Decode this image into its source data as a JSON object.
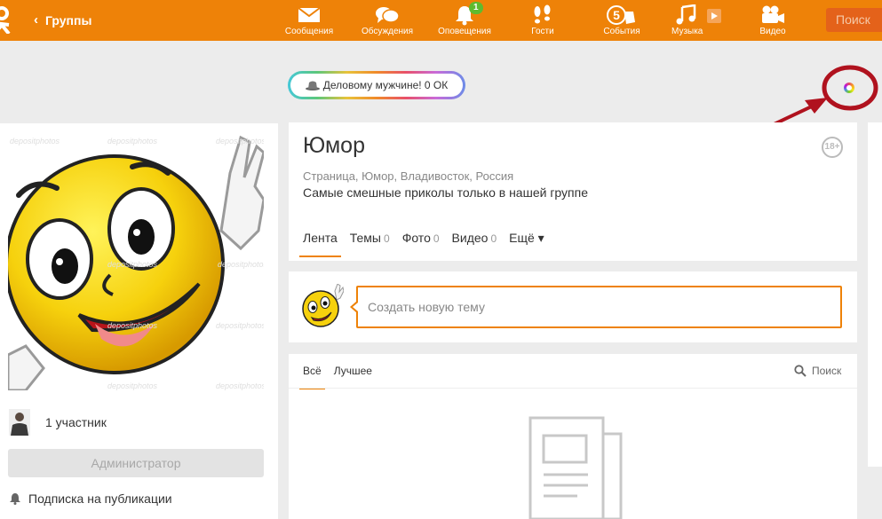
{
  "topbar": {
    "back_label": "Группы",
    "search_label": "Поиск",
    "nav": [
      {
        "label": "Сообщения",
        "icon": "envelope-icon"
      },
      {
        "label": "Обсуждения",
        "icon": "chat-bubbles-icon"
      },
      {
        "label": "Оповещения",
        "icon": "bell-icon",
        "badge": "1"
      },
      {
        "label": "Гости",
        "icon": "footprints-icon"
      },
      {
        "label": "События",
        "icon": "five-plus-icon"
      },
      {
        "label": "Музыка",
        "icon": "music-note-icon"
      },
      {
        "label": "Видео",
        "icon": "video-camera-icon"
      }
    ]
  },
  "promo": {
    "text": "Деловому мужчине! 0 ОК",
    "icon": "hat-icon"
  },
  "left": {
    "members_text": "1 участник",
    "admin_button": "Администратор",
    "subscribe_text": "Подписка на публикации",
    "watermark": "depositphotos"
  },
  "group": {
    "title": "Юмор",
    "age_badge": "18+",
    "meta": "Страница, Юмор, Владивосток, Россия",
    "description": "Самые смешные приколы только в нашей группе",
    "tabs": [
      {
        "label": "Лента",
        "count": "",
        "active": true
      },
      {
        "label": "Темы",
        "count": "0"
      },
      {
        "label": "Фото",
        "count": "0"
      },
      {
        "label": "Видео",
        "count": "0"
      },
      {
        "label": "Ещё ▾",
        "count": ""
      }
    ]
  },
  "new_topic": {
    "placeholder": "Создать новую тему"
  },
  "feed": {
    "tabs": [
      {
        "label": "Всё",
        "active": true
      },
      {
        "label": "Лучшее"
      }
    ],
    "search_label": "Поиск"
  },
  "colors": {
    "accent": "#ee8208",
    "annotation": "#b0121e"
  }
}
